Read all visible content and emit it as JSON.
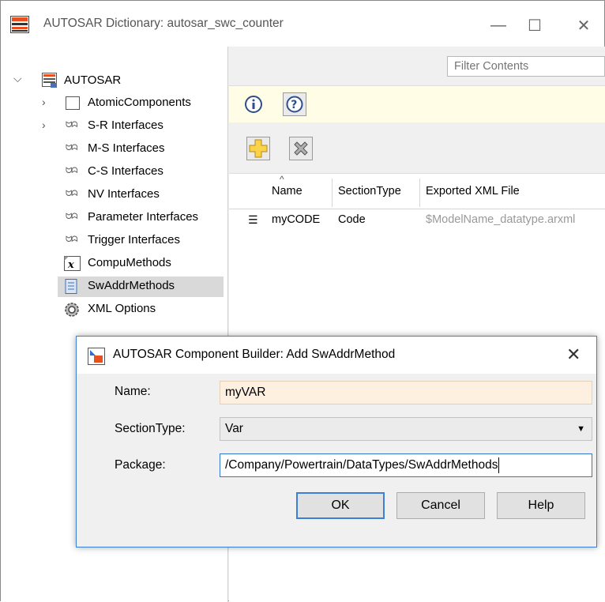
{
  "window": {
    "title": "AUTOSAR Dictionary: autosar_swc_counter",
    "minimize_glyph": "—",
    "maximize_glyph": "☐",
    "close_glyph": "✕"
  },
  "tree": {
    "root": "AUTOSAR",
    "items": [
      {
        "label": "AtomicComponents",
        "icon": "component-icon",
        "expandable": true
      },
      {
        "label": "S-R Interfaces",
        "icon": "interface-icon",
        "expandable": true
      },
      {
        "label": "M-S Interfaces",
        "icon": "interface-icon",
        "expandable": false
      },
      {
        "label": "C-S Interfaces",
        "icon": "interface-icon",
        "expandable": false
      },
      {
        "label": "NV Interfaces",
        "icon": "interface-icon",
        "expandable": false
      },
      {
        "label": "Parameter Interfaces",
        "icon": "interface-icon",
        "expandable": false
      },
      {
        "label": "Trigger Interfaces",
        "icon": "interface-icon",
        "expandable": false
      },
      {
        "label": "CompuMethods",
        "icon": "compu-icon",
        "expandable": false
      },
      {
        "label": "SwAddrMethods",
        "icon": "list-icon",
        "expandable": false,
        "selected": true
      },
      {
        "label": "XML Options",
        "icon": "gear-icon",
        "expandable": false
      }
    ]
  },
  "content": {
    "filter_placeholder": "Filter Contents",
    "columns": [
      "Name",
      "SectionType",
      "Exported XML File"
    ],
    "rows": [
      {
        "name": "myCODE",
        "section_type": "Code",
        "xml_file": "$ModelName_datatype.arxml"
      }
    ]
  },
  "dialog": {
    "title": "AUTOSAR Component Builder: Add SwAddrMethod",
    "close_glyph": "✕",
    "name_label": "Name:",
    "name_value": "myVAR",
    "section_label": "SectionType:",
    "section_value": "Var",
    "package_label": "Package:",
    "package_value": "/Company/Powertrain/DataTypes/SwAddrMethods",
    "ok_label": "OK",
    "cancel_label": "Cancel",
    "help_label": "Help"
  },
  "colors": {
    "info_bar": "#fffde6",
    "selected_row": "#d9d9d9",
    "name_field": "#fdf0e1",
    "focus_border": "#3c7fd6"
  }
}
